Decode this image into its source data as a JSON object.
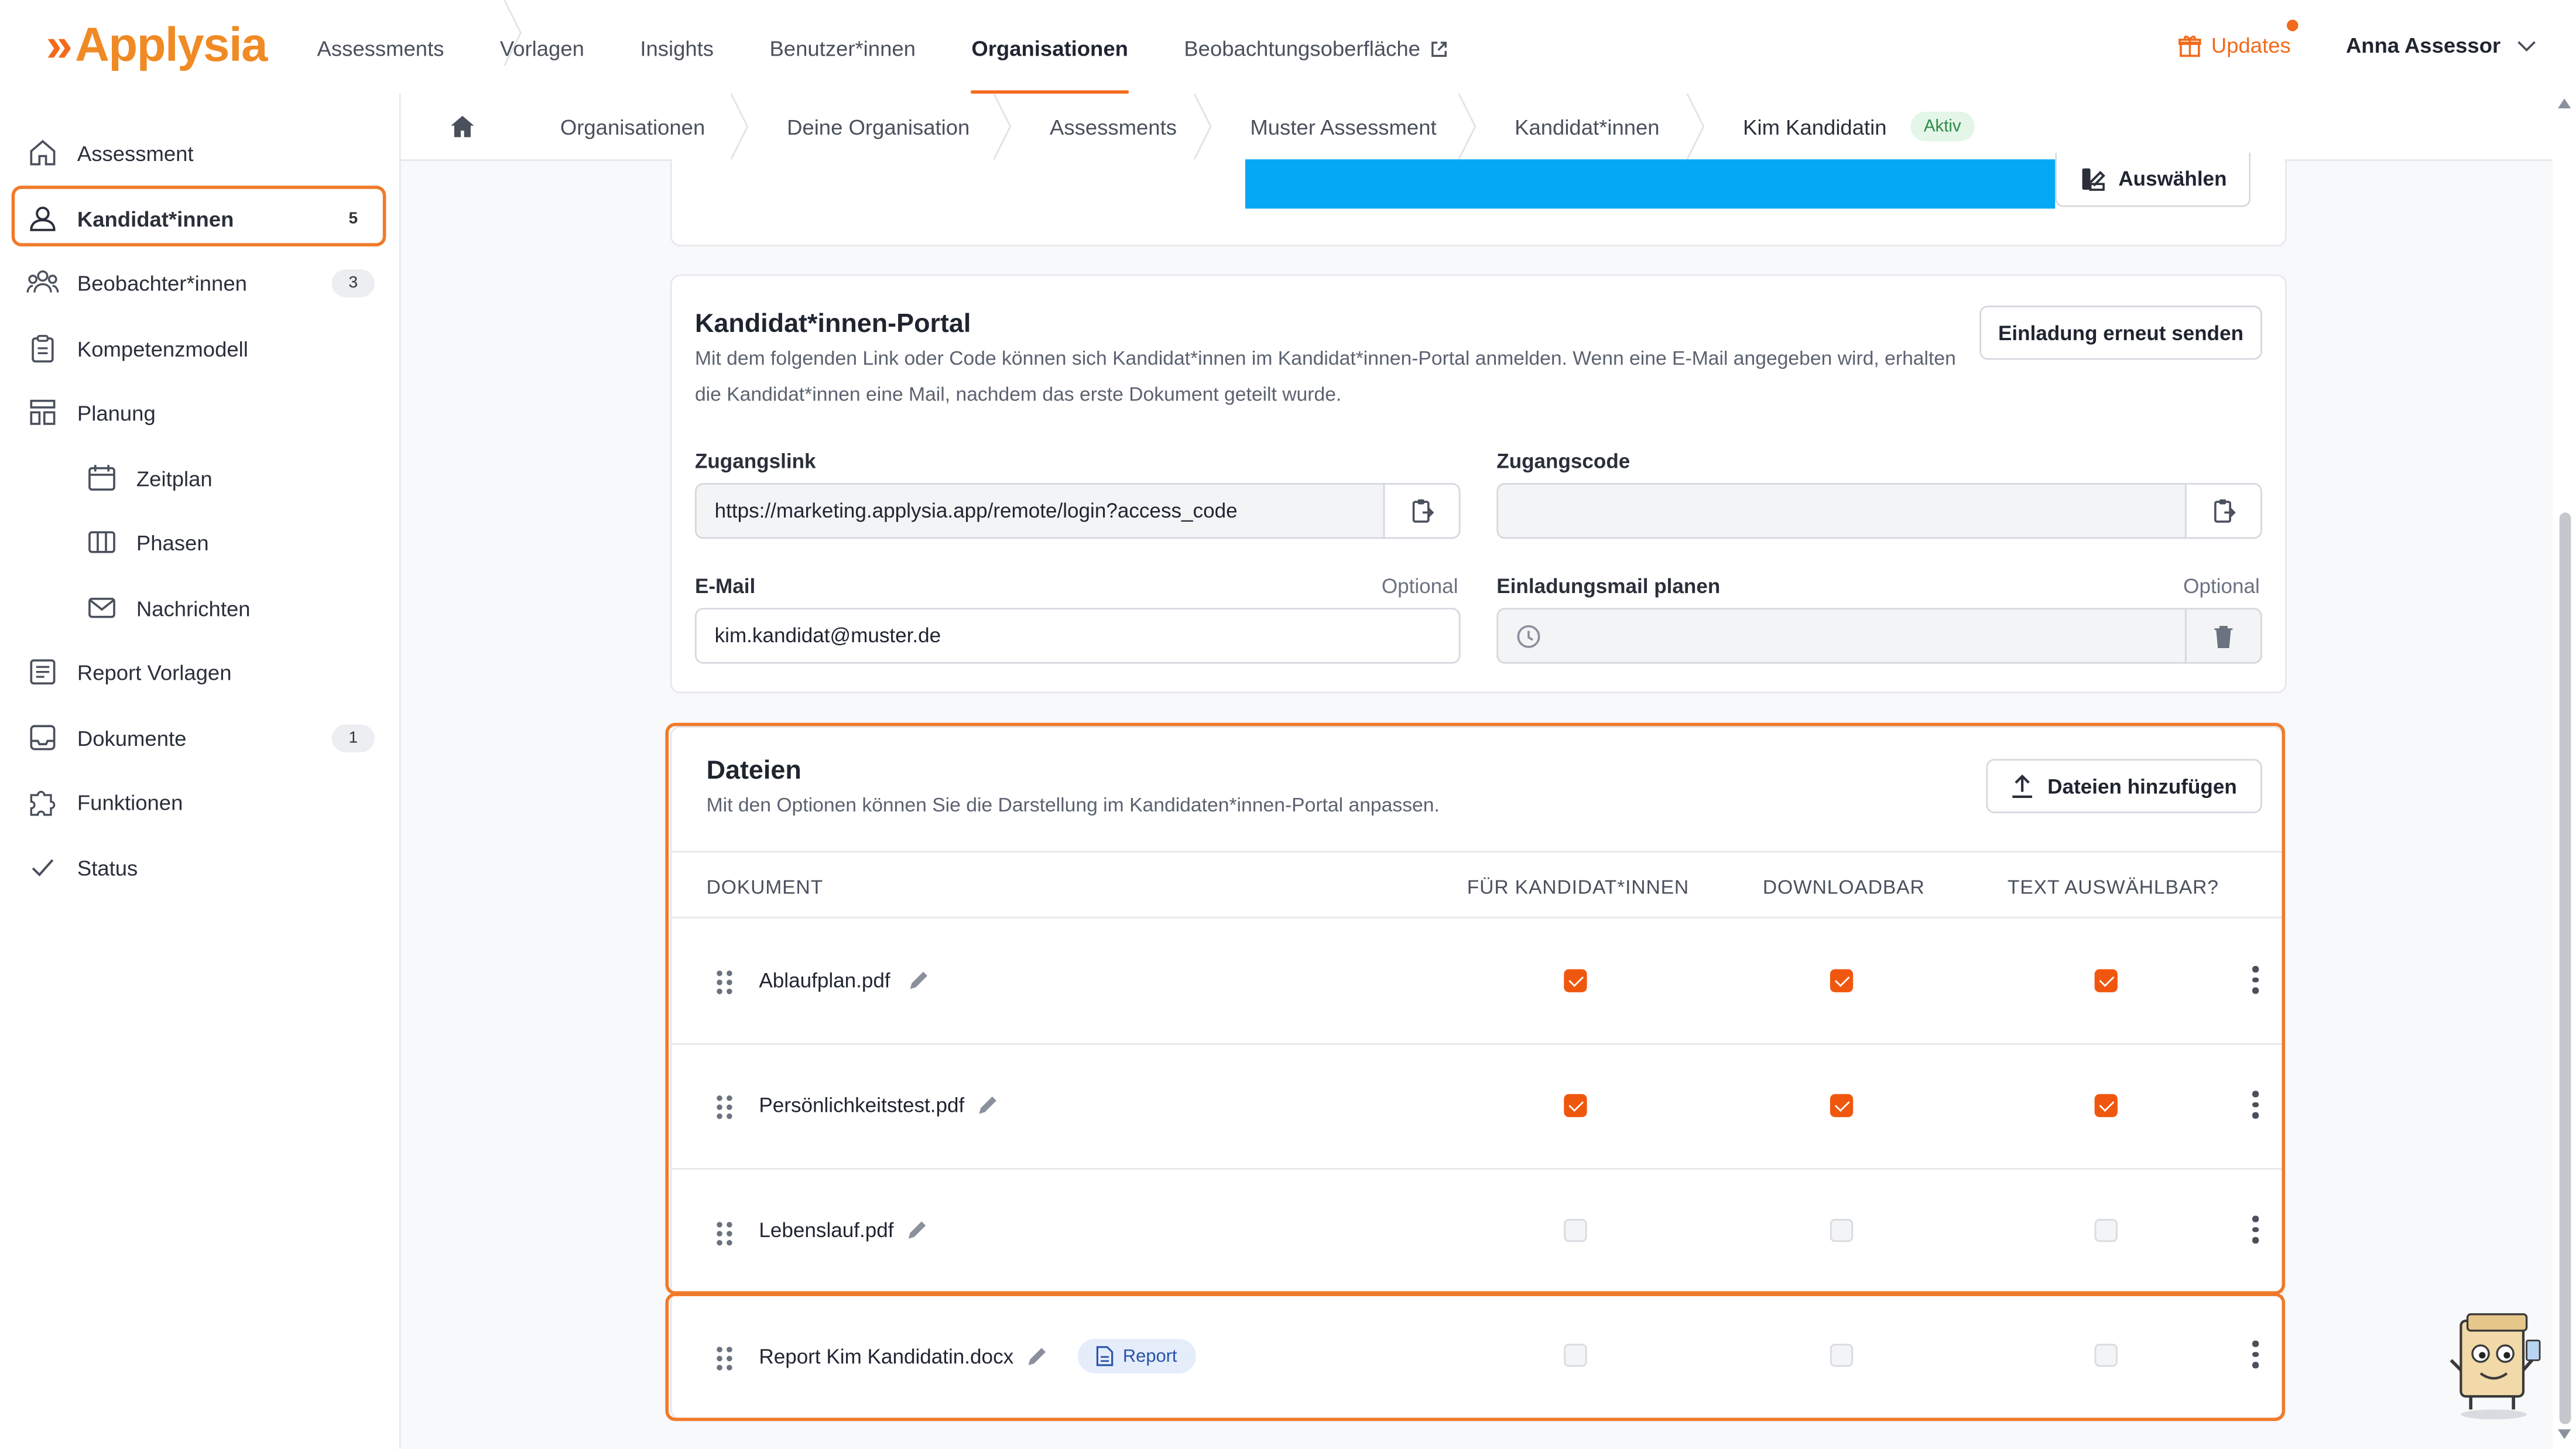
{
  "brand": {
    "name": "Applysia",
    "accent": "#f26a1b"
  },
  "nav": {
    "items": [
      "Assessments",
      "Vorlagen",
      "Insights",
      "Benutzer*innen",
      "Organisationen",
      "Beobachtungsoberfläche"
    ],
    "active": "Organisationen"
  },
  "header": {
    "updates_label": "Updates",
    "user_name": "Anna Assessor"
  },
  "sidebar": {
    "items": [
      {
        "label": "Assessment",
        "icon": "home-icon"
      },
      {
        "label": "Kandidat*innen",
        "icon": "users-icon",
        "badge": "5"
      },
      {
        "label": "Beobachter*innen",
        "icon": "group-icon",
        "badge": "3"
      },
      {
        "label": "Kompetenzmodell",
        "icon": "clipboard-icon"
      },
      {
        "label": "Planung",
        "icon": "layout-icon"
      },
      {
        "label": "Zeitplan",
        "icon": "calendar-icon"
      },
      {
        "label": "Phasen",
        "icon": "columns-icon"
      },
      {
        "label": "Nachrichten",
        "icon": "mail-icon"
      },
      {
        "label": "Report Vorlagen",
        "icon": "report-icon"
      },
      {
        "label": "Dokumente",
        "icon": "inbox-icon",
        "badge": "1"
      },
      {
        "label": "Funktionen",
        "icon": "puzzle-icon"
      },
      {
        "label": "Status",
        "icon": "check-icon"
      }
    ]
  },
  "breadcrumb": {
    "items": [
      "Organisationen",
      "Deine Organisation",
      "Assessments",
      "Muster Assessment",
      "Kandidat*innen",
      "Kim Kandidatin"
    ],
    "status_badge": "Aktiv"
  },
  "top_card": {
    "select_label": "Auswählen"
  },
  "portal": {
    "title": "Kandidat*innen-Portal",
    "description": "Mit dem folgenden Link oder Code können sich Kandidat*innen im Kandidat*innen-Portal anmelden. Wenn eine E-Mail angegeben wird, erhalten die Kandidat*innen eine Mail, nachdem das erste Dokument geteilt wurde.",
    "resend_label": "Einladung erneut senden",
    "access_link_label": "Zugangslink",
    "access_link_value": "https://marketing.applysia.app/remote/login?access_code",
    "access_code_label": "Zugangscode",
    "access_code_value": "",
    "email_label": "E-Mail",
    "email_optional": "Optional",
    "email_value": "kim.kandidat@muster.de",
    "schedule_label": "Einladungsmail planen",
    "schedule_optional": "Optional",
    "schedule_value": ""
  },
  "files": {
    "title": "Dateien",
    "description": "Mit den Optionen können Sie die Darstellung im Kandidaten*innen-Portal anpassen.",
    "add_label": "Dateien hinzufügen",
    "columns": [
      "DOKUMENT",
      "FÜR KANDIDAT*INNEN",
      "DOWNLOADBAR",
      "TEXT AUSWÄHLBAR?"
    ],
    "rows": [
      {
        "name": "Ablaufplan.pdf",
        "for_candidates": true,
        "downloadable": true,
        "text_selectable": true
      },
      {
        "name": "Persönlichkeitstest.pdf",
        "for_candidates": true,
        "downloadable": true,
        "text_selectable": true
      },
      {
        "name": "Lebenslauf.pdf",
        "for_candidates": false,
        "downloadable": false,
        "text_selectable": false
      },
      {
        "name": "Report Kim Kandidatin.docx",
        "for_candidates": false,
        "downloadable": false,
        "text_selectable": false,
        "tag": "Report"
      }
    ]
  }
}
